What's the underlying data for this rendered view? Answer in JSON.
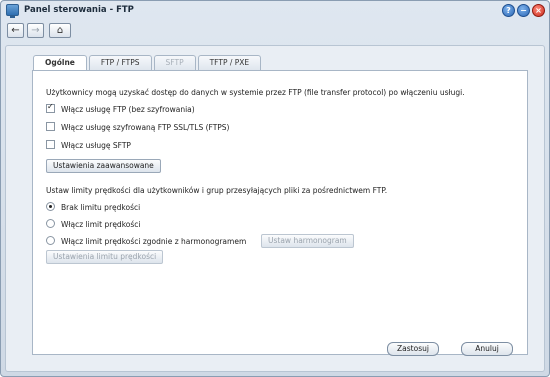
{
  "window": {
    "title": "Panel sterowania - FTP"
  },
  "titlebar": {
    "help_glyph": "?",
    "minimize_glyph": "−",
    "close_glyph": "×"
  },
  "nav": {
    "back_glyph": "←",
    "forward_glyph": "→",
    "home_glyph": "⌂"
  },
  "tabs": [
    {
      "label": "Ogólne",
      "state": "active"
    },
    {
      "label": "FTP / FTPS",
      "state": "normal"
    },
    {
      "label": "SFTP",
      "state": "disabled"
    },
    {
      "label": "TFTP / PXE",
      "state": "normal"
    }
  ],
  "general": {
    "intro": "Użytkownicy mogą uzyskać dostęp do danych w systemie przez FTP (file transfer protocol) po włączeniu usługi.",
    "options": [
      {
        "label": "Włącz usługę FTP (bez szyfrowania)",
        "checked": true
      },
      {
        "label": "Włącz usługę szyfrowaną FTP SSL/TLS (FTPS)",
        "checked": false
      },
      {
        "label": "Włącz usługę SFTP",
        "checked": false
      }
    ],
    "advanced_button": "Ustawienia zaawansowane",
    "speed_intro": "Ustaw limity prędkości dla użytkowników i grup przesyłających pliki za pośrednictwem FTP.",
    "speed_options": [
      {
        "label": "Brak limitu prędkości",
        "selected": true
      },
      {
        "label": "Włącz limit prędkości",
        "selected": false
      },
      {
        "label": "Włącz limit prędkości zgodnie z harmonogramem",
        "selected": false
      }
    ],
    "schedule_button": "Ustaw harmonogram",
    "speed_settings_button": "Ustawienia limitu prędkości"
  },
  "footer": {
    "apply": "Zastosuj",
    "cancel": "Anuluj"
  }
}
